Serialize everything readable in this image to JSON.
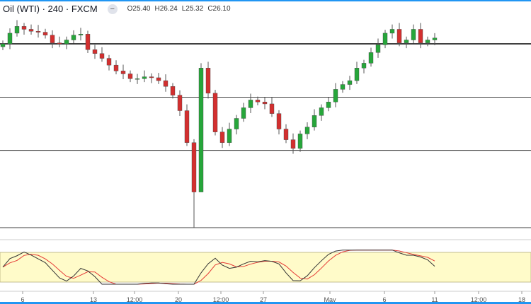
{
  "header": {
    "symbol": "Oil (WTI)",
    "interval": "240",
    "source": "FXCM",
    "open": "O25.40",
    "high": "H26.24",
    "low": "L25.32",
    "close": "C26.10"
  },
  "colors": {
    "up": "#26a63a",
    "down": "#d32f2f",
    "band": "#fffbc9",
    "k": "#333333",
    "d": "#e53935"
  },
  "chart_data": {
    "type": "candlestick",
    "closes": [
      25.5,
      26.6,
      27.3,
      27.0,
      26.8,
      26.7,
      26.4,
      25.6,
      25.5,
      25.9,
      26.4,
      26.5,
      24.9,
      24.5,
      24.0,
      23.3,
      22.7,
      22.4,
      21.9,
      21.9,
      22.1,
      22.0,
      21.7,
      21.1,
      20.2,
      18.6,
      15.3,
      10.2,
      23.0,
      20.4,
      16.4,
      15.3,
      16.7,
      17.8,
      18.9,
      19.7,
      19.5,
      19.3,
      18.3,
      16.7,
      15.6,
      14.7,
      16.2,
      16.9,
      18.1,
      18.9,
      19.5,
      20.8,
      21.3,
      21.7,
      23.0,
      23.5,
      24.6,
      25.4,
      26.6,
      27.0,
      25.6,
      25.9,
      27.0,
      25.6,
      25.9,
      26.1
    ],
    "special_lows": {
      "27": 6.5,
      "28": 11.5
    },
    "horizontal_levels": [
      25.5,
      20.0,
      14.5
    ],
    "ylim": [
      6.5,
      28.3
    ],
    "stochastic_band": [
      20,
      80
    ],
    "x_tick_labels": [
      "6",
      "13",
      "12:00",
      "20",
      "12:00",
      "27",
      "May",
      "6",
      "11",
      "12:00",
      "18"
    ]
  }
}
